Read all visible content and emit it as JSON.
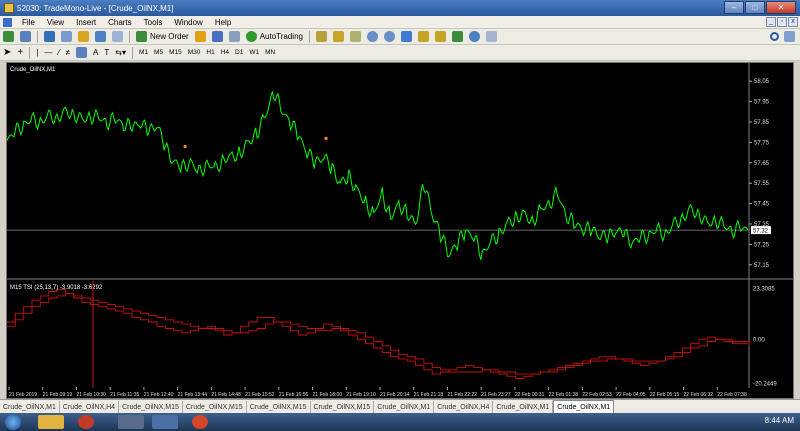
{
  "window": {
    "title": "52030: TradeMono-Live - [Crude_OilNX,M1]",
    "min_icon": "minimize-icon",
    "max_icon": "maximize-icon",
    "close_icon": "close-icon",
    "min_glyph": "–",
    "max_glyph": "□",
    "close_glyph": "✕"
  },
  "menu": [
    "File",
    "View",
    "Insert",
    "Charts",
    "Tools",
    "Window",
    "Help"
  ],
  "child_buttons": [
    "_",
    "▫",
    "x"
  ],
  "toolbar": {
    "new_order": "New Order",
    "autotrading": "AutoTrading"
  },
  "timeframes": [
    "M1",
    "M5",
    "M15",
    "M30",
    "H1",
    "H4",
    "D1",
    "W1",
    "MN"
  ],
  "main_chart": {
    "label": "Crude_OilNX,M1",
    "current_price": "57.32",
    "colors": {
      "line": "#00ff00",
      "background": "#000000",
      "hline": "#8c8c8c",
      "marker": "#ff8c1a"
    }
  },
  "indicator": {
    "label": "M15 TSI (25,13,7) -3.9018 -3.6292",
    "top_label": "23.3085",
    "mid_label": "0.00",
    "bottom_label": "-20.2449",
    "colors": {
      "line": "#cc1111"
    }
  },
  "chart_data": [
    {
      "type": "line",
      "title": "Crude_OilNX,M1",
      "y_ticks": [
        58.05,
        57.95,
        57.85,
        57.75,
        57.65,
        57.55,
        57.45,
        57.35,
        57.25,
        57.15
      ],
      "ylim": [
        57.1,
        58.1
      ],
      "current_price": 57.32,
      "series": [
        {
          "values": [
            57.76,
            57.8,
            57.84,
            57.86,
            57.85,
            57.88,
            57.87,
            57.9,
            57.89,
            57.86,
            57.88,
            57.87,
            57.85,
            57.86,
            57.84,
            57.82,
            57.85,
            57.8,
            57.84,
            57.72,
            57.66,
            57.62,
            57.66,
            57.6,
            57.65,
            57.62,
            57.67,
            57.68,
            57.7,
            57.75,
            57.8,
            57.88,
            58.0,
            57.9,
            57.85,
            57.78,
            57.7,
            57.65,
            57.68,
            57.62,
            57.55,
            57.58,
            57.52,
            57.45,
            57.4,
            57.5,
            57.38,
            57.45,
            57.4,
            57.35,
            57.55,
            57.4,
            57.3,
            57.2,
            57.25,
            57.32,
            57.28,
            57.2,
            57.26,
            57.3,
            57.35,
            57.38,
            57.4,
            57.36,
            57.42,
            57.45,
            57.5,
            57.4,
            57.35,
            57.33,
            57.32,
            57.3,
            57.28,
            57.32,
            57.3,
            57.26,
            57.28,
            57.3,
            57.32,
            57.3,
            57.35,
            57.38,
            57.42,
            57.4,
            57.35,
            57.37,
            57.34,
            57.32,
            57.33,
            57.32
          ]
        }
      ],
      "markers": [
        57.73,
        57.77
      ]
    },
    {
      "type": "line",
      "title": "M15 TSI (25,13,7) -3.9018 -3.6292",
      "y_ticks": [
        23.3085,
        0.0,
        -20.2449
      ],
      "ylim": [
        -21,
        25
      ],
      "series": [
        {
          "values": [
            8,
            12,
            15,
            18,
            20,
            22,
            23,
            21,
            19,
            17,
            16,
            15,
            14,
            13,
            12,
            10,
            9,
            8,
            6,
            5,
            4,
            3,
            4,
            5,
            6,
            4,
            2,
            3,
            6,
            8,
            10,
            10,
            8,
            6,
            4,
            2,
            3,
            5,
            7,
            6,
            4,
            2,
            0,
            -2,
            -4,
            -6,
            -8,
            -9,
            -10,
            -12,
            -14,
            -16,
            -15,
            -14,
            -13,
            -12,
            -13,
            -14,
            -15,
            -16,
            -17,
            -18,
            -17,
            -16,
            -15,
            -14,
            -13,
            -12,
            -11,
            -10,
            -9,
            -8,
            -8,
            -9,
            -10,
            -11,
            -12,
            -11,
            -10,
            -8,
            -6,
            -4,
            -2,
            0,
            1,
            0,
            -1,
            -2,
            -2,
            -3
          ]
        },
        {
          "values": [
            6,
            9,
            12,
            15,
            17,
            19,
            20,
            21,
            20,
            19,
            18,
            17,
            16,
            15,
            14,
            13,
            12,
            11,
            10,
            9,
            8,
            7,
            6,
            5,
            5,
            5,
            4,
            3,
            3,
            4,
            5,
            7,
            8,
            8,
            7,
            6,
            5,
            4,
            4,
            5,
            5,
            4,
            3,
            1,
            -1,
            -3,
            -5,
            -7,
            -8,
            -9,
            -11,
            -13,
            -14,
            -15,
            -15,
            -15,
            -15,
            -14,
            -14,
            -15,
            -15,
            -16,
            -16,
            -16,
            -15,
            -15,
            -14,
            -13,
            -12,
            -11,
            -10,
            -10,
            -9,
            -9,
            -9,
            -10,
            -10,
            -10,
            -10,
            -9,
            -8,
            -6,
            -4,
            -3,
            -1,
            0,
            0,
            -1,
            -1,
            -2
          ]
        }
      ]
    }
  ],
  "time_axis": [
    "21 Feb 2019",
    "21 Feb 09:19",
    "21 Feb 10:30",
    "21 Feb 11:35",
    "21 Feb 12:40",
    "21 Feb 13:44",
    "21 Feb 14:48",
    "21 Feb 15:52",
    "21 Feb 16:56",
    "21 Feb 18:00",
    "21 Feb 19:10",
    "21 Feb 20:14",
    "21 Feb 21:18",
    "21 Feb 22:22",
    "21 Feb 23:27",
    "22 Feb 00:31",
    "22 Feb 01:38",
    "22 Feb 02:53",
    "22 Feb 04:05",
    "22 Feb 05:15",
    "22 Feb 06:32",
    "22 Feb 07:38"
  ],
  "tabs": [
    "Crude_OilNX,M1",
    "Crude_OilNX,H4",
    "Crude_OilNX,M15",
    "Crude_OilNX,M15",
    "Crude_OilNX,M15",
    "Crude_OilNX,M15",
    "Crude_OilNX,M1",
    "Crude_OilNX,H4",
    "Crude_OilNX,M1",
    "Crude_OilNX,M1"
  ],
  "active_tab": 9,
  "taskbar": {
    "clock": "8:44 AM"
  }
}
